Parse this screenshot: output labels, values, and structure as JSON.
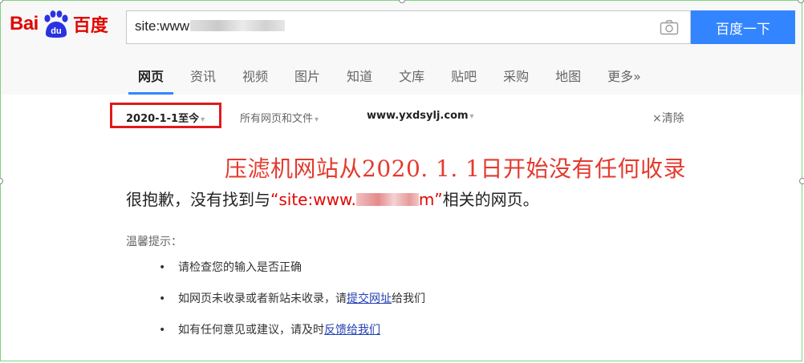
{
  "header": {
    "logo_text_latin": "Bai",
    "logo_text_paw": "du",
    "logo_text_cn": "百度",
    "search_value": "site:www",
    "search_button": "百度一下",
    "camera_icon": "camera-icon"
  },
  "tabs": [
    {
      "label": "网页",
      "active": true
    },
    {
      "label": "资讯"
    },
    {
      "label": "视频"
    },
    {
      "label": "图片"
    },
    {
      "label": "知道"
    },
    {
      "label": "文库"
    },
    {
      "label": "贴吧"
    },
    {
      "label": "采购"
    },
    {
      "label": "地图"
    },
    {
      "label": "更多»"
    }
  ],
  "filters": {
    "time": "2020-1-1至今",
    "type": "所有网页和文件",
    "site": "www.yxdsylj.com",
    "clear": "×清除",
    "arrow": "▾"
  },
  "annotation": "压滤机网站从2020. 1. 1日开始没有任何收录",
  "result": {
    "sorry_prefix": "很抱歉，没有找到与",
    "query_open": "“site:www.",
    "query_close": "m”",
    "sorry_suffix": "相关的网页。"
  },
  "tips": {
    "title": "温馨提示：",
    "item1": "请检查您的输入是否正确",
    "item2_prefix": "如网页未收录或者新站未收录，请",
    "item2_link": "提交网址",
    "item2_suffix": "给我们",
    "item3_prefix": "如有任何意见或建议，请及时",
    "item3_link": "反馈给我们"
  },
  "colors": {
    "brand_red": "#e10601",
    "search_blue": "#3385ff",
    "annotation_red": "#e43a2e",
    "link_blue": "#2440b3"
  }
}
